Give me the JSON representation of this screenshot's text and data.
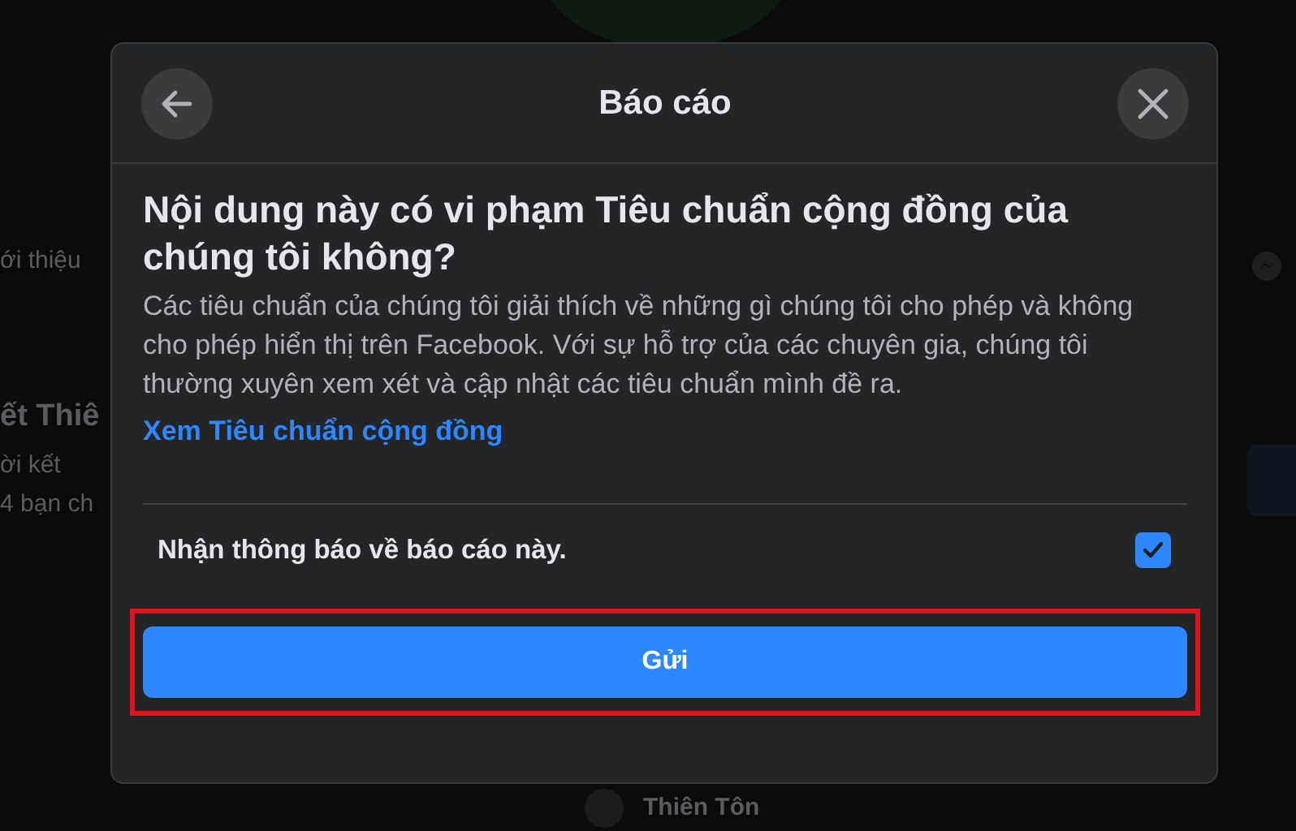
{
  "background": {
    "fragments": [
      {
        "kind": "text",
        "text": "ới thiệu"
      },
      {
        "kind": "title",
        "text": "ết Thiê"
      },
      {
        "kind": "text",
        "text": "ời kết"
      },
      {
        "kind": "text",
        "text": "4 bạn ch"
      }
    ],
    "bottom_name": "Thiên Tôn"
  },
  "dialog": {
    "title": "Báo cáo",
    "heading": "Nội dung này có vi phạm Tiêu chuẩn cộng đồng của chúng tôi không?",
    "description": "Các tiêu chuẩn của chúng tôi giải thích về những gì chúng tôi cho phép và không cho phép hiển thị trên Facebook. Với sự hỗ trợ của các chuyên gia, chúng tôi thường xuyên xem xét và cập nhật các tiêu chuẩn mình đề ra.",
    "link": "Xem Tiêu chuẩn cộng đồng",
    "notify": {
      "label": "Nhận thông báo về báo cáo này.",
      "checked": true
    },
    "submit": {
      "label": "Gửi",
      "highlighted": true
    }
  }
}
